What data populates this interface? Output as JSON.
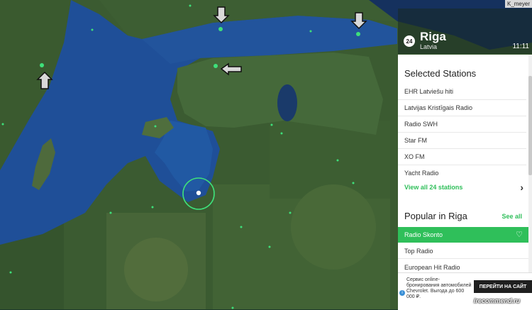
{
  "watermark_user": "K_meyer",
  "city": {
    "badge": "24",
    "name": "Riga",
    "country": "Latvia",
    "time": "11:11"
  },
  "selected": {
    "title": "Selected Stations",
    "stations": [
      "EHR Latviešu hiti",
      "Latvijas Kristīgais Radio",
      "Radio SWH",
      "Star FM",
      "XO FM",
      "Yacht Radio"
    ],
    "view_all": "View all 24 stations"
  },
  "popular": {
    "title": "Popular in Riga",
    "see_all": "See all",
    "stations": [
      "Radio Skonto",
      "Top Radio",
      "European Hit Radio"
    ]
  },
  "ad": {
    "text": "Сервис online-бронирования автомобилей Chevrolet. Выгода до 600 000 ₽.",
    "button": "ПЕРЕЙТИ НА САЙТ"
  },
  "site_watermark": "irecommend.ru",
  "colors": {
    "accent": "#2fbf5a",
    "sea": "#1f4f98",
    "land": "#355a2e"
  },
  "icons": [
    "down-arrow-icon",
    "up-arrow-icon",
    "left-arrow-icon",
    "chevron-right-icon",
    "heart-icon",
    "info-icon"
  ]
}
